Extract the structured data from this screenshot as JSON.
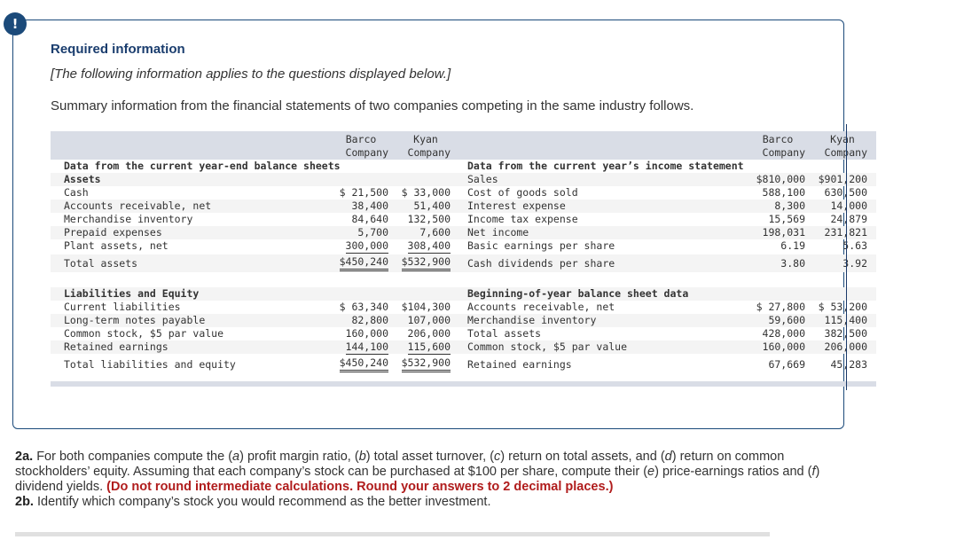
{
  "alert": {
    "icon": "!"
  },
  "info": {
    "title": "Required information",
    "note": "[The following information applies to the questions displayed below.]",
    "summary": "Summary information from the financial statements of two companies competing in the same industry follows."
  },
  "columns": {
    "barco": [
      "Barco",
      "Company"
    ],
    "kyan": [
      "Kyan",
      "Company"
    ]
  },
  "balance_sheet": {
    "heading": "Data from the current year-end balance sheets",
    "assets_heading": "Assets",
    "assets": [
      {
        "label": "Cash",
        "barco": "$ 21,500",
        "kyan": "$ 33,000"
      },
      {
        "label": "Accounts receivable, net",
        "barco": "38,400",
        "kyan": "51,400"
      },
      {
        "label": "Merchandise inventory",
        "barco": "84,640",
        "kyan": "132,500"
      },
      {
        "label": "Prepaid expenses",
        "barco": "5,700",
        "kyan": "7,600"
      },
      {
        "label": "Plant assets, net",
        "barco": "300,000",
        "kyan": "308,400"
      }
    ],
    "total_assets": {
      "label": "Total assets",
      "barco": "$450,240",
      "kyan": "$532,900"
    },
    "liab_heading": "Liabilities and Equity",
    "liabilities": [
      {
        "label": "Current liabilities",
        "barco": "$ 63,340",
        "kyan": "$104,300"
      },
      {
        "label": "Long-term notes payable",
        "barco": "82,800",
        "kyan": "107,000"
      },
      {
        "label": "Common stock, $5 par value",
        "barco": "160,000",
        "kyan": "206,000"
      },
      {
        "label": "Retained earnings",
        "barco": "144,100",
        "kyan": "115,600"
      }
    ],
    "total_liab": {
      "label": "Total liabilities and equity",
      "barco": "$450,240",
      "kyan": "$532,900"
    }
  },
  "income_statement": {
    "heading": "Data from the current year’s income statement",
    "rows": [
      {
        "label": "Sales",
        "barco": "$810,000",
        "kyan": "$901,200"
      },
      {
        "label": "Cost of goods sold",
        "barco": "588,100",
        "kyan": "630,500"
      },
      {
        "label": "Interest expense",
        "barco": "8,300",
        "kyan": "14,000"
      },
      {
        "label": "Income tax expense",
        "barco": "15,569",
        "kyan": "24,879"
      },
      {
        "label": "Net income",
        "barco": "198,031",
        "kyan": "231,821"
      },
      {
        "label": "Basic earnings per share",
        "barco": "6.19",
        "kyan": "5.63"
      }
    ],
    "dividends": {
      "label": "Cash dividends per share",
      "barco": "3.80",
      "kyan": "3.92"
    }
  },
  "beginning_balance": {
    "heading": "Beginning-of-year balance sheet data",
    "rows": [
      {
        "label": "Accounts receivable, net",
        "barco": "$ 27,800",
        "kyan": "$ 53,200"
      },
      {
        "label": "Merchandise inventory",
        "barco": "59,600",
        "kyan": "115,400"
      },
      {
        "label": "Total assets",
        "barco": "428,000",
        "kyan": "382,500"
      },
      {
        "label": "Common stock, $5 par value",
        "barco": "160,000",
        "kyan": "206,000"
      }
    ],
    "last": {
      "label": "Retained earnings",
      "barco": "67,669",
      "kyan": "45,283"
    }
  },
  "question": {
    "p2a_label": "2a.",
    "p2a_t1": " For both companies compute the (",
    "a": "a",
    "p2a_t2": ") profit margin ratio, (",
    "b": "b",
    "p2a_t3": ") total asset turnover, (",
    "c": "c",
    "p2a_t4": ") return on total assets, and (",
    "d": "d",
    "p2a_t5": ") return on common stockholders’ equity. Assuming that each company’s stock can be purchased at $100 per share, compute their (",
    "e": "e",
    "p2a_t6": ") price-earnings ratios and (",
    "f": "f",
    "p2a_t7": ") dividend yields. ",
    "warning": "(Do not round intermediate calculations. Round your answers to 2 decimal places.)",
    "p2b_label": "2b.",
    "p2b_text": " Identify which company’s stock you would recommend as the better investment."
  }
}
